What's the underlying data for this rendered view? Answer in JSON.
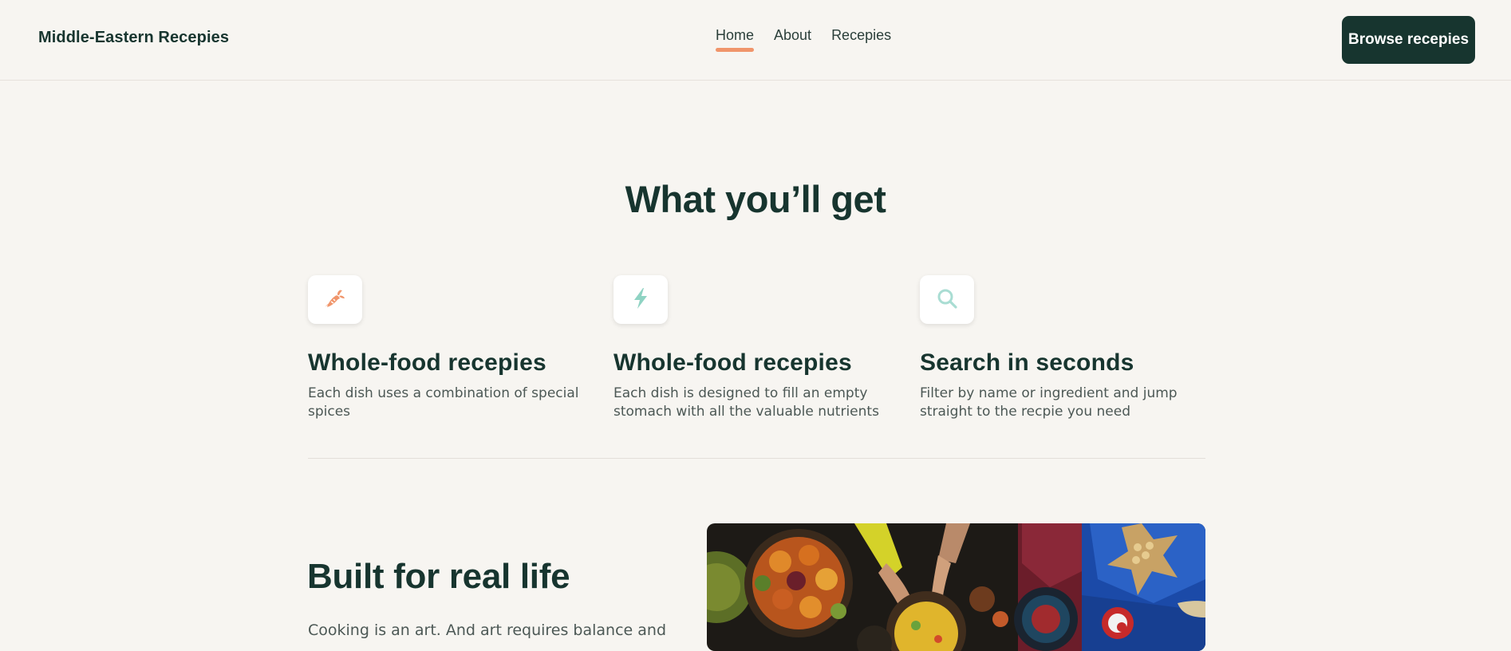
{
  "header": {
    "brand": "Middle-Eastern Recepies",
    "nav": [
      {
        "label": "Home",
        "active": true
      },
      {
        "label": "About",
        "active": false
      },
      {
        "label": "Recepies",
        "active": false
      }
    ],
    "cta_label": "Browse recepies"
  },
  "features_section": {
    "title": "What you’ll get",
    "items": [
      {
        "icon": "carrot-icon",
        "icon_color": "#f0956b",
        "title": "Whole-food recepies",
        "description_lines": [
          "Each dish uses a combination of special",
          "spices"
        ]
      },
      {
        "icon": "lightning-icon",
        "icon_color": "#8fd3c3",
        "title": "Whole-food recepies",
        "description_lines": [
          "Each dish is designed to fill an empty",
          "stomach with all the valuable nutrients"
        ]
      },
      {
        "icon": "search-icon",
        "icon_color": "#a9ddd3",
        "title": "Search in seconds",
        "description_lines": [
          "Filter by name or ingredient and jump",
          "straight to the recpie you need"
        ]
      }
    ]
  },
  "built_section": {
    "title": "Built for real life",
    "text": "Cooking is an art. And art requires balance and"
  },
  "colors": {
    "background": "#f7f5f1",
    "brand_dark": "#17352f",
    "accent": "#f0956b"
  }
}
